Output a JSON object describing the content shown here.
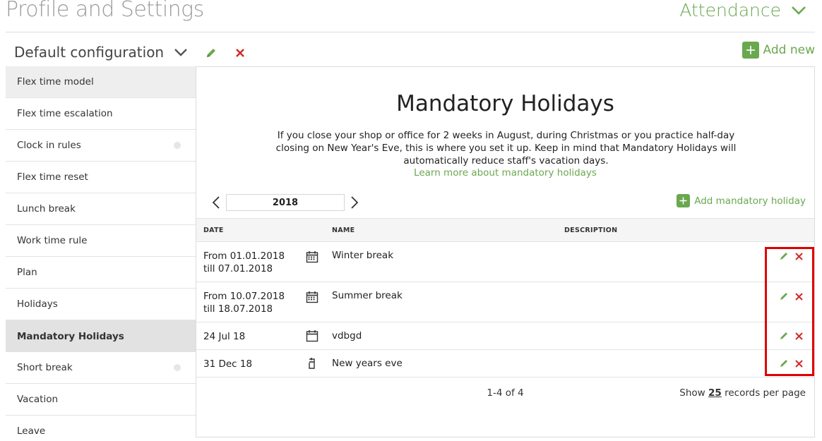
{
  "header": {
    "title": "Profile and Settings",
    "module": "Attendance"
  },
  "config": {
    "selected": "Default configuration",
    "add_new_label": "Add new"
  },
  "sidebar": {
    "items": [
      {
        "label": "Flex time model"
      },
      {
        "label": "Flex time escalation"
      },
      {
        "label": "Clock in rules"
      },
      {
        "label": "Flex time reset"
      },
      {
        "label": "Lunch break"
      },
      {
        "label": "Work time rule"
      },
      {
        "label": "Plan"
      },
      {
        "label": "Holidays"
      },
      {
        "label": "Mandatory Holidays"
      },
      {
        "label": "Short break"
      },
      {
        "label": "Vacation"
      },
      {
        "label": "Leave"
      }
    ]
  },
  "main": {
    "title": "Mandatory Holidays",
    "description": "If you close your shop or office for 2 weeks in August, during Christmas or you practice half-day closing on New Year's Eve, this is where you set it up. Keep in mind that Mandatory Holidays will automatically reduce staff's vacation days.",
    "learn_more": "Learn more about mandatory holidays",
    "year": "2018",
    "add_holiday_label": "Add mandatory holiday",
    "columns": {
      "date": "DATE",
      "name": "NAME",
      "description": "DESCRIPTION"
    },
    "rows": [
      {
        "date": "From 01.01.2018 till 07.01.2018",
        "name": "Winter break",
        "description": ""
      },
      {
        "date": "From 10.07.2018 till 18.07.2018",
        "name": "Summer break",
        "description": ""
      },
      {
        "date": "24 Jul 18",
        "name": "vdbgd",
        "description": ""
      },
      {
        "date": "31 Dec 18",
        "name": "New years eve",
        "description": ""
      }
    ],
    "pager": {
      "count": "1-4 of 4",
      "show_prefix": "Show",
      "per_page_value": "25",
      "show_suffix": "records per page"
    }
  },
  "colors": {
    "accent_green": "#6aa84f",
    "delete_red": "#d22b2b",
    "highlight_red": "#e00000"
  },
  "icons": {
    "module_dropdown": "chevron-down-icon",
    "config_dropdown": "chevron-down-icon",
    "edit": "pencil-icon",
    "delete": "close-icon",
    "add": "plus-icon",
    "calendar": "calendar-icon",
    "prev": "chevron-left-icon",
    "next": "chevron-right-icon"
  }
}
